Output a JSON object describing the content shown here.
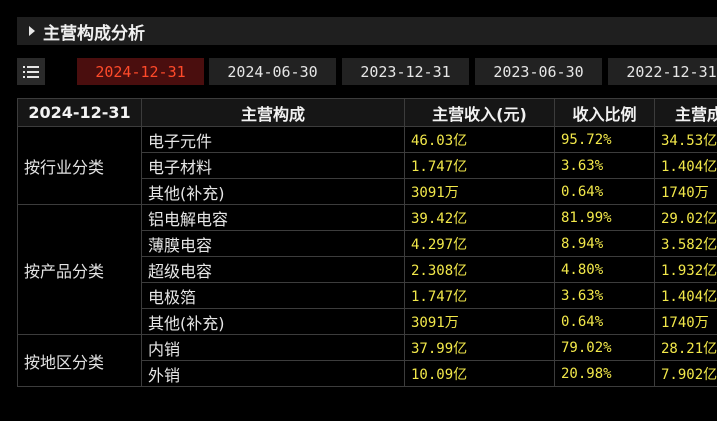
{
  "section": {
    "title": "主营构成分析"
  },
  "tabs": [
    {
      "label": "2024-12-31",
      "active": true
    },
    {
      "label": "2024-06-30"
    },
    {
      "label": "2023-12-31"
    },
    {
      "label": "2023-06-30"
    },
    {
      "label": "2022-12-31"
    }
  ],
  "table": {
    "headers": [
      "2024-12-31",
      "主营构成",
      "主营收入(元)",
      "收入比例",
      "主营成"
    ],
    "groups": [
      {
        "label": "按行业分类",
        "rows": [
          {
            "name": "电子元件",
            "revenue": "46.03亿",
            "ratio": "95.72%",
            "cost": "34.53亿"
          },
          {
            "name": "电子材料",
            "revenue": "1.747亿",
            "ratio": "3.63%",
            "cost": "1.404亿"
          },
          {
            "name": "其他(补充)",
            "revenue": "3091万",
            "ratio": "0.64%",
            "cost": "1740万"
          }
        ]
      },
      {
        "label": "按产品分类",
        "rows": [
          {
            "name": "铝电解电容",
            "revenue": "39.42亿",
            "ratio": "81.99%",
            "cost": "29.02亿"
          },
          {
            "name": "薄膜电容",
            "revenue": "4.297亿",
            "ratio": "8.94%",
            "cost": "3.582亿"
          },
          {
            "name": "超级电容",
            "revenue": "2.308亿",
            "ratio": "4.80%",
            "cost": "1.932亿"
          },
          {
            "name": "电极箔",
            "revenue": "1.747亿",
            "ratio": "3.63%",
            "cost": "1.404亿"
          },
          {
            "name": "其他(补充)",
            "revenue": "3091万",
            "ratio": "0.64%",
            "cost": "1740万"
          }
        ]
      },
      {
        "label": "按地区分类",
        "rows": [
          {
            "name": "内销",
            "revenue": "37.99亿",
            "ratio": "79.02%",
            "cost": "28.21亿"
          },
          {
            "name": "外销",
            "revenue": "10.09亿",
            "ratio": "20.98%",
            "cost": "7.902亿"
          }
        ]
      }
    ]
  },
  "colors": {
    "background": "#000000",
    "active_tab_bg": "#4a0e0e",
    "active_tab_text": "#ff4a2a",
    "number_text": "#f2e84a"
  },
  "icons": {
    "menu": "list-icon",
    "section": "caret-right-icon"
  }
}
